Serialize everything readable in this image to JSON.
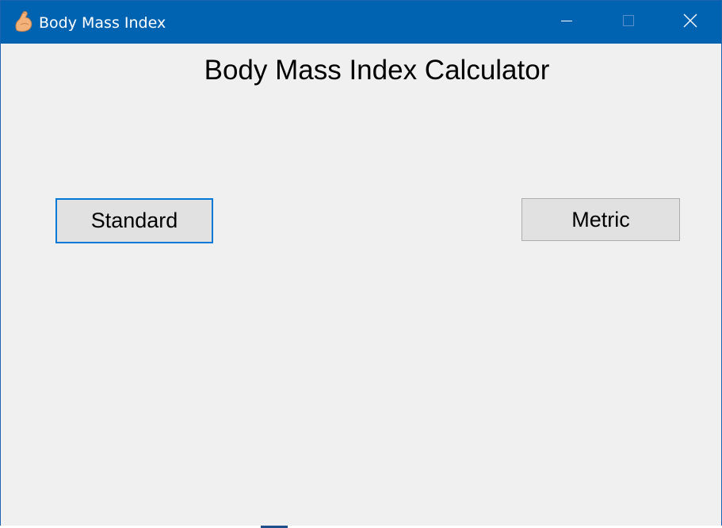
{
  "window": {
    "title": "Body Mass Index",
    "app_icon": "flexed-arm-icon",
    "title_bar_color": "#0063b1",
    "controls": {
      "minimize_icon": "minimize-icon",
      "maximize_icon": "maximize-icon",
      "close_icon": "close-icon"
    }
  },
  "main": {
    "heading": "Body Mass Index Calculator",
    "buttons": {
      "standard_label": "Standard",
      "metric_label": "Metric"
    },
    "focus_color": "#0078d7"
  }
}
